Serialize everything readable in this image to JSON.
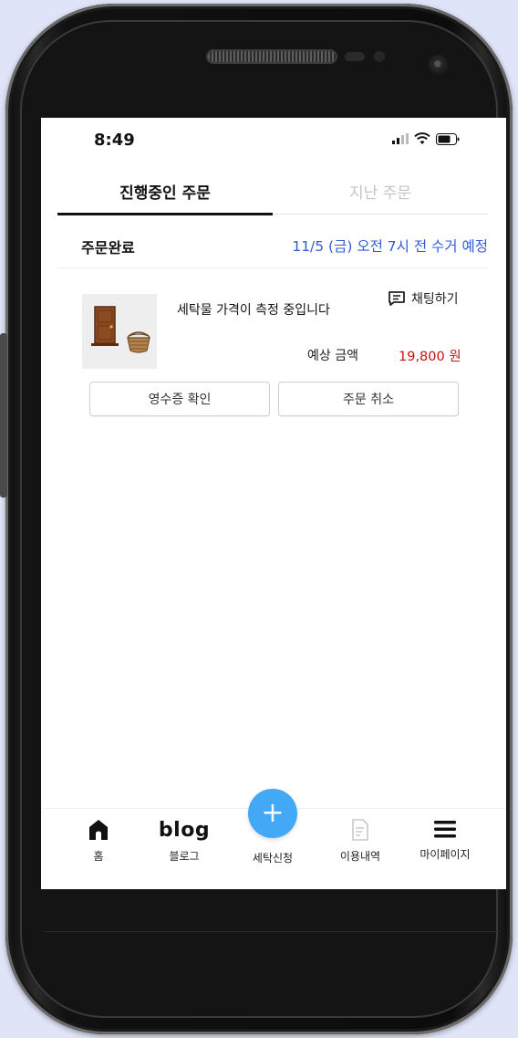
{
  "status_bar": {
    "time": "8:49"
  },
  "tabs": [
    {
      "label": "진행중인 주문",
      "active": true
    },
    {
      "label": "지난 주문",
      "active": false
    }
  ],
  "order": {
    "status": "주문완료",
    "pickup_schedule": "11/5 (금) 오전 7시 전 수거 예정",
    "item_description": "세탁물 가격이 측정 중입니다",
    "chat_label": "채팅하기",
    "price_label": "예상 금액",
    "price_value": "19,800 원",
    "receipt_button": "영수증 확인",
    "cancel_button": "주문 취소"
  },
  "bottom_nav": {
    "home_label": "홈",
    "blog_logo": "blog",
    "blog_label": "블로그",
    "fab_symbol": "+",
    "laundry_label": "세탁신청",
    "history_label": "이용내역",
    "mypage_label": "마이페이지"
  },
  "colors": {
    "accent": "#43a8f5",
    "pickup_text": "#2f5bd8",
    "price_text": "#cc1111"
  }
}
